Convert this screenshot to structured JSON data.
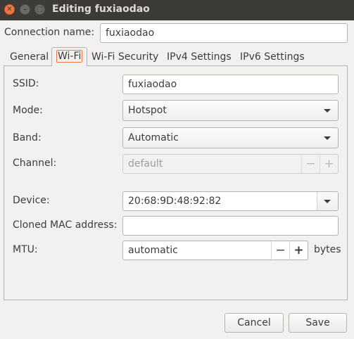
{
  "window": {
    "title": "Editing fuxiaodao"
  },
  "connection_name": {
    "label": "Connection name:",
    "value": "fuxiaodao"
  },
  "tabs": [
    {
      "label": "General"
    },
    {
      "label": "Wi-Fi"
    },
    {
      "label": "Wi-Fi Security"
    },
    {
      "label": "IPv4 Settings"
    },
    {
      "label": "IPv6 Settings"
    }
  ],
  "wifi": {
    "ssid": {
      "label": "SSID:",
      "value": "fuxiaodao"
    },
    "mode": {
      "label": "Mode:",
      "value": "Hotspot"
    },
    "band": {
      "label": "Band:",
      "value": "Automatic"
    },
    "channel": {
      "label": "Channel:",
      "value": "default",
      "minus": "−",
      "plus": "+"
    },
    "device": {
      "label": "Device:",
      "value": "20:68:9D:48:92:82"
    },
    "cloned_mac": {
      "label": "Cloned MAC address:",
      "value": ""
    },
    "mtu": {
      "label": "MTU:",
      "value": "automatic",
      "minus": "−",
      "plus": "+",
      "unit": "bytes"
    }
  },
  "buttons": {
    "cancel": "Cancel",
    "save": "Save"
  },
  "icons": {
    "close": "close-icon",
    "minimize": "minimize-icon",
    "maximize": "maximize-icon",
    "dropdown": "chevron-down-icon"
  },
  "colors": {
    "titlebar": "#3c3b37",
    "accent": "#f07746",
    "window_bg": "#f2f1f0"
  }
}
